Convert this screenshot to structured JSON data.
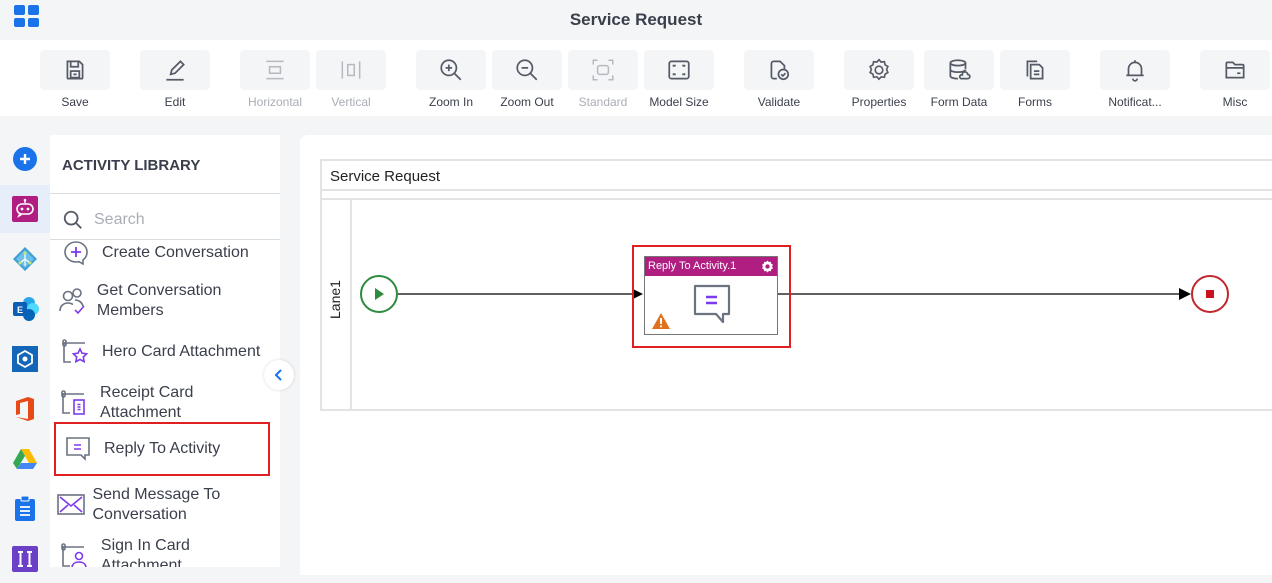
{
  "header": {
    "title": "Service Request"
  },
  "toolbar": {
    "items": [
      {
        "label": "Save",
        "icon": "save-icon",
        "disabled": false
      },
      {
        "label": "Edit",
        "icon": "edit-icon",
        "disabled": false
      },
      {
        "label": "Horizontal",
        "icon": "horizontal-icon",
        "disabled": true
      },
      {
        "label": "Vertical",
        "icon": "vertical-icon",
        "disabled": true
      },
      {
        "label": "Zoom In",
        "icon": "zoom-in-icon",
        "disabled": false
      },
      {
        "label": "Zoom Out",
        "icon": "zoom-out-icon",
        "disabled": false
      },
      {
        "label": "Standard",
        "icon": "standard-icon",
        "disabled": true
      },
      {
        "label": "Model Size",
        "icon": "model-size-icon",
        "disabled": false
      },
      {
        "label": "Validate",
        "icon": "validate-icon",
        "disabled": false
      },
      {
        "label": "Properties",
        "icon": "gear-icon",
        "disabled": false
      },
      {
        "label": "Form Data",
        "icon": "database-icon",
        "disabled": false
      },
      {
        "label": "Forms",
        "icon": "forms-icon",
        "disabled": false
      },
      {
        "label": "Notificat...",
        "icon": "bell-icon",
        "disabled": false
      },
      {
        "label": "Misc",
        "icon": "folder-icon",
        "disabled": false
      }
    ]
  },
  "rail": {
    "items": [
      {
        "name": "add",
        "icon": "add-circle-icon"
      },
      {
        "name": "bot",
        "icon": "bot-icon",
        "active": true
      },
      {
        "name": "azure-ad",
        "icon": "azure-ad-icon"
      },
      {
        "name": "exchange",
        "icon": "exchange-icon"
      },
      {
        "name": "hexagon-app",
        "icon": "hexagon-app-icon"
      },
      {
        "name": "office",
        "icon": "office-icon"
      },
      {
        "name": "google-drive",
        "icon": "google-drive-icon"
      },
      {
        "name": "clipboard",
        "icon": "clipboard-icon"
      },
      {
        "name": "purple-app",
        "icon": "purple-app-icon"
      }
    ]
  },
  "library": {
    "title": "ACTIVITY LIBRARY",
    "search_placeholder": "Search",
    "items": [
      {
        "label": "Create Conversation",
        "icon": "chat-plus-icon"
      },
      {
        "label": "Get Conversation Members",
        "icon": "members-icon"
      },
      {
        "label": "Hero Card Attachment",
        "icon": "hero-card-icon"
      },
      {
        "label": "Receipt Card Attachment",
        "icon": "receipt-card-icon"
      },
      {
        "label": "Reply To Activity",
        "icon": "reply-chat-icon",
        "selected": true
      },
      {
        "label": "Send Message To Conversation",
        "icon": "envelope-icon"
      },
      {
        "label": "Sign In Card Attachment",
        "icon": "sign-in-card-icon"
      }
    ]
  },
  "canvas": {
    "pool_title": "Service Request",
    "lane_label": "Lane1",
    "task": {
      "title": "Reply To Activity.1",
      "warning": true
    },
    "accent": "#b01e82",
    "start_color": "#2e8b3e",
    "end_color": "#c0282d"
  }
}
